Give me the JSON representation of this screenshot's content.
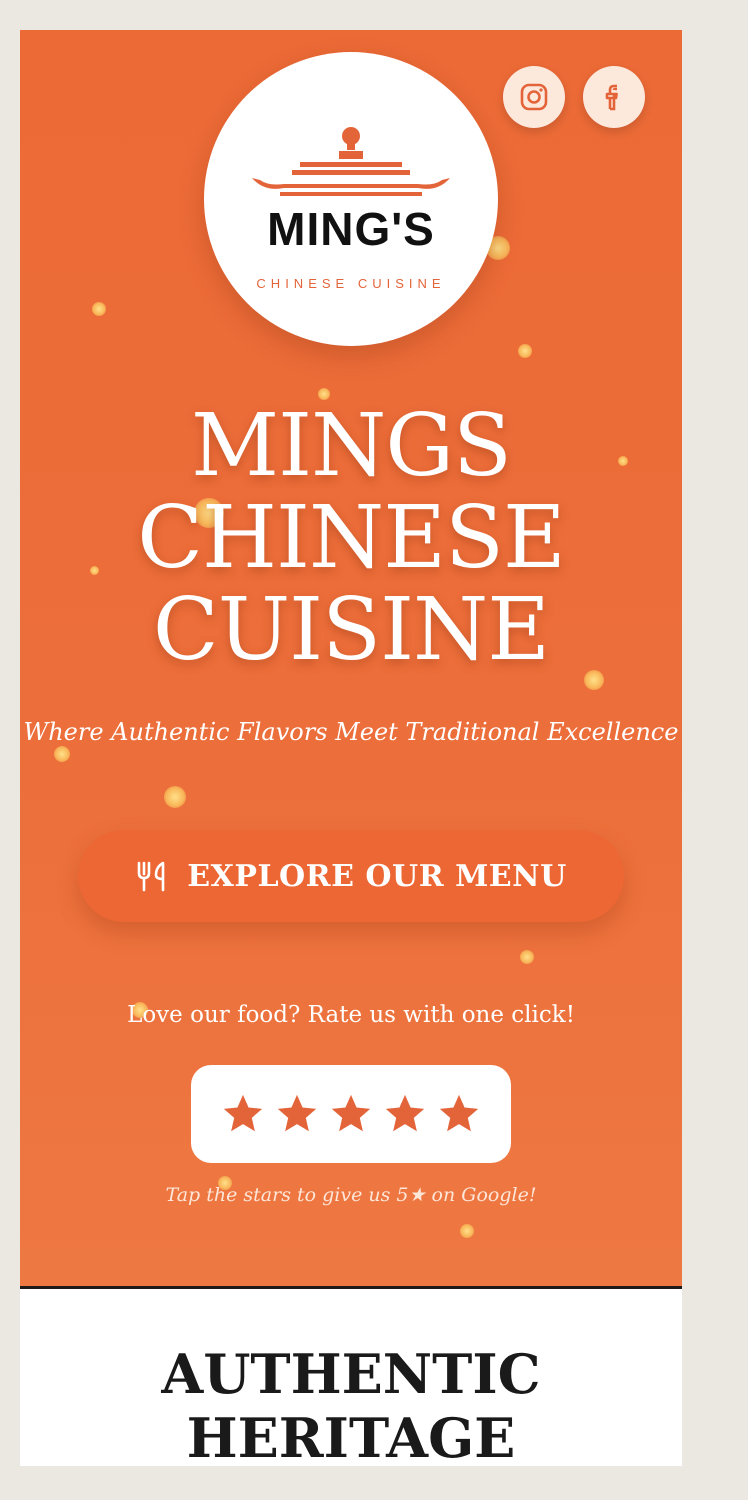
{
  "brand": {
    "logo_word": "MING'S",
    "logo_sub": "CHINESE CUISINE"
  },
  "social": {
    "instagram_icon": "instagram-icon",
    "facebook_icon": "facebook-icon"
  },
  "hero": {
    "title_lines": [
      "MINGS",
      "CHINESE",
      "CUISINE"
    ],
    "tagline": "Where Authentic Flavors Meet Traditional Excellence",
    "menu_button": {
      "icon": "fork-knife-icon",
      "label": "EXPLORE OUR MENU"
    },
    "rating": {
      "prompt": "Love our food? Rate us with one click!",
      "stars": 5,
      "hint": "Tap the stars to give us 5★ on Google!"
    }
  },
  "section": {
    "heading": "AUTHENTIC HERITAGE"
  },
  "colors": {
    "accent": "#ec6a36",
    "white": "#ffffff",
    "dark": "#1a1a1a"
  }
}
